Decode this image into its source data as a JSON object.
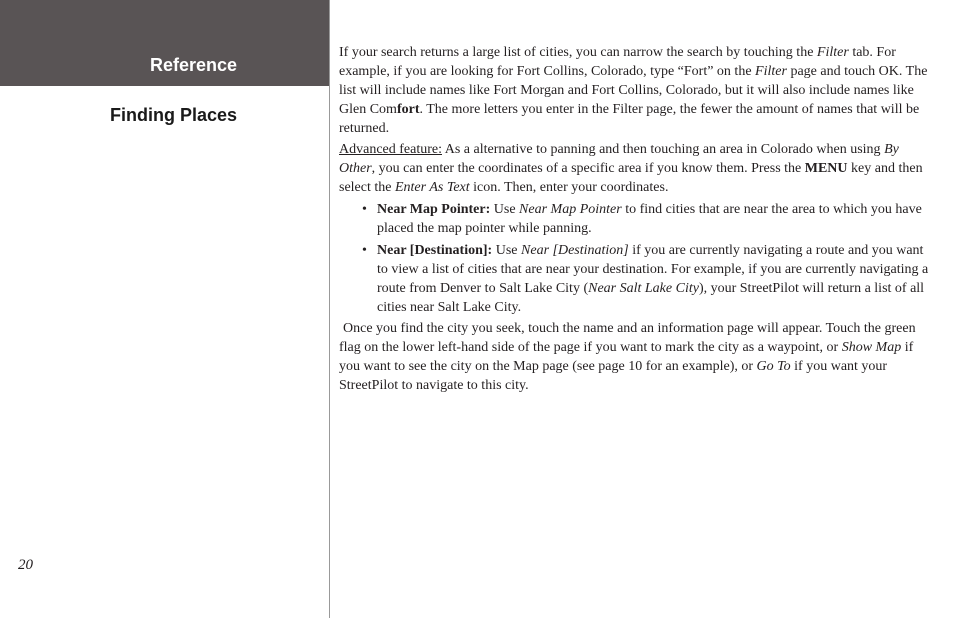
{
  "sidebar": {
    "reference_label": "Reference",
    "section_label": "Finding Places"
  },
  "page_number": "20",
  "para1": {
    "t1": "If your search returns a large list of cities, you can narrow the search by touching the ",
    "filter1": "Filter",
    "t2": " tab. For example, if you are looking for Fort Collins, Colorado, type “Fort” on the ",
    "filter2": "Filter",
    "t3": " page and touch OK. The list will include names like Fort Morgan and Fort Collins, Colorado, but it will also include names like Glen Com",
    "bold_fort": "fort",
    "t4": ". The more letters you enter in the Filter page, the fewer the amount of names that will be returned."
  },
  "adv": {
    "label": "Advanced feature:",
    "t1": " As a alternative to panning and then touching an area in Colorado when using ",
    "byother": "By Other",
    "t2": ", you can enter the coordinates of a specific area if you know them. Press the ",
    "menu": "MENU",
    "t3": " key and then select the ",
    "enter_as_text": "Enter As Text",
    "t4": " icon. Then, enter your coordinates."
  },
  "bullets": [
    {
      "bold": "Near Map Pointer:",
      "t1": " Use ",
      "ital": "Near Map Pointer",
      "t2": " to find cities that are near the area to which you have placed the map pointer while panning."
    },
    {
      "bold": "Near [Destination]:",
      "t1": " Use ",
      "ital": "Near [Destination]",
      "t2": " if you are currently navigating a route and you want to view a list of cities that are near your destination. For example, if you are currently navigating a route from Denver to Salt Lake City (",
      "ital2": "Near Salt Lake City",
      "t3": "), your StreetPilot will return a list of all cities near Salt Lake City."
    }
  ],
  "para2": {
    "t1": " Once you find the city you seek, touch the name and an information page will appear. Touch the green flag on the lower left-hand side of the page if you want to mark the city as a waypoint, or ",
    "showmap": "Show Map",
    "t2": " if you want to see the city on the Map page (see page 10 for an example), or ",
    "goto": "Go To",
    "t3": " if you want your StreetPilot to navigate to this city."
  }
}
